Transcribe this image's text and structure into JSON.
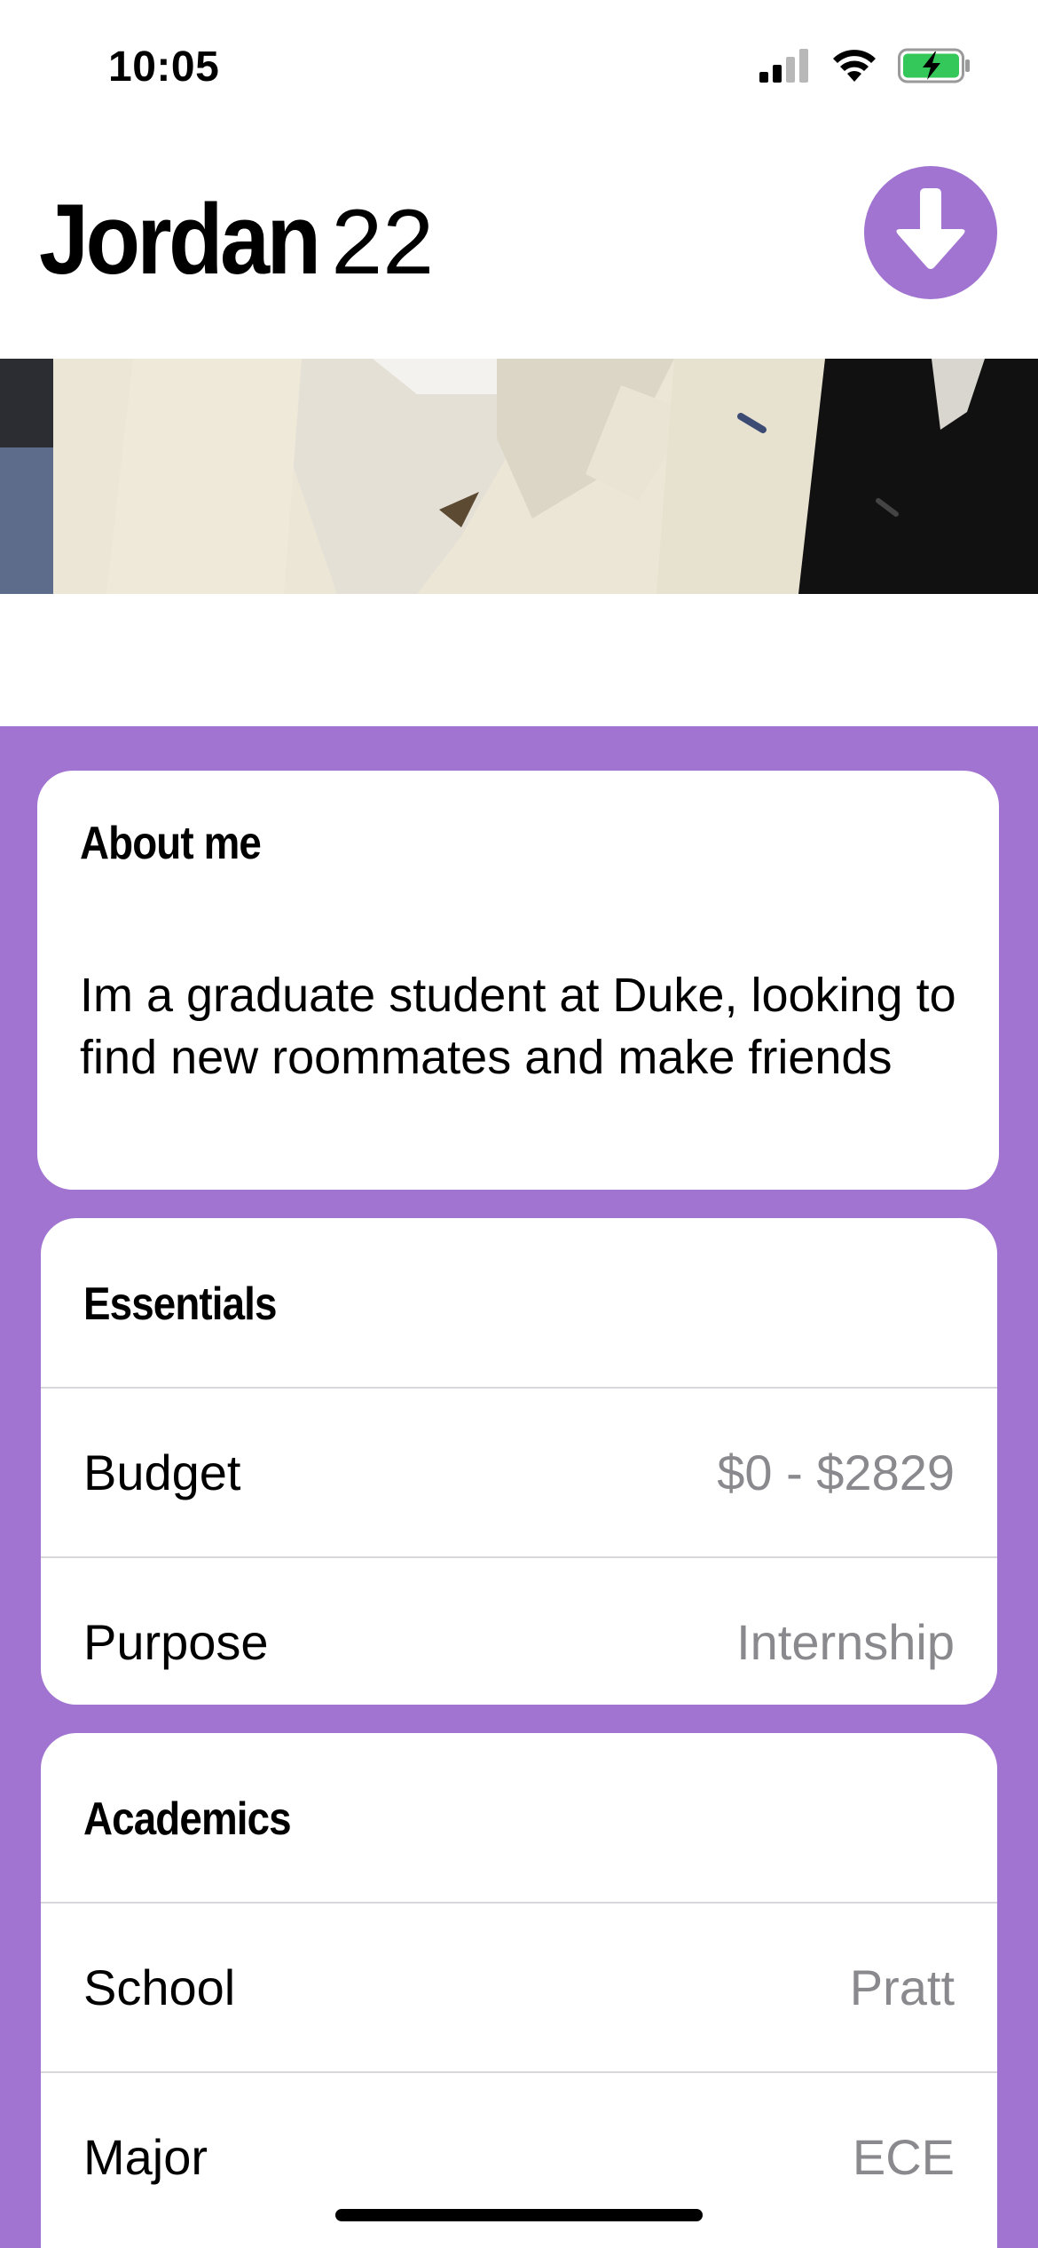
{
  "status_bar": {
    "time": "10:05",
    "icons": [
      "cellular-signal-icon",
      "wifi-icon",
      "battery-charging-icon"
    ],
    "battery_color": "#34c759"
  },
  "profile": {
    "name": "Jordan",
    "age": "22",
    "action_icon": "arrow-down-icon"
  },
  "colors": {
    "accent": "#a074d0",
    "secondary_text": "#8a8a8e"
  },
  "about": {
    "title": "About me",
    "text": "Im a graduate student at Duke, looking to find new roommates and make friends"
  },
  "essentials": {
    "title": "Essentials",
    "rows": [
      {
        "label": "Budget",
        "value": "$0 - $2829"
      },
      {
        "label": "Purpose",
        "value": "Internship"
      }
    ]
  },
  "academics": {
    "title": "Academics",
    "rows": [
      {
        "label": "School",
        "value": "Pratt"
      },
      {
        "label": "Major",
        "value": "ECE"
      }
    ]
  }
}
